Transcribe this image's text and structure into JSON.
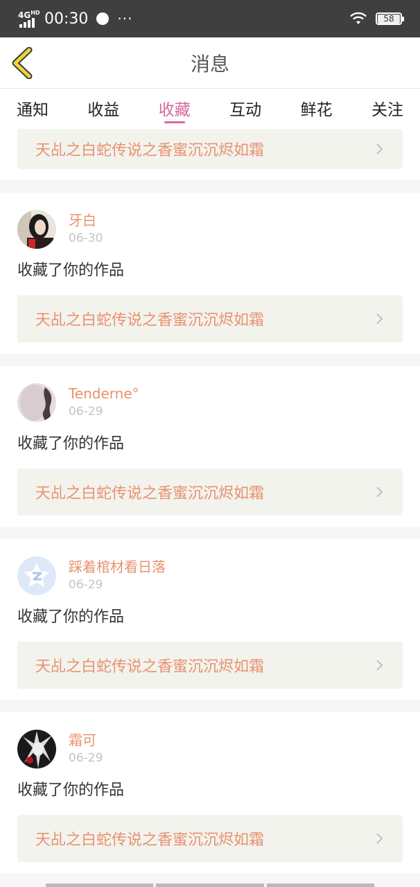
{
  "status_bar": {
    "network": "4G",
    "network_sup": "HD",
    "time": "00:30",
    "more": "···",
    "battery": "58"
  },
  "header": {
    "title": "消息"
  },
  "tabs": [
    {
      "label": "通知"
    },
    {
      "label": "收益"
    },
    {
      "label": "收藏",
      "active": true
    },
    {
      "label": "互动"
    },
    {
      "label": "鲜花"
    },
    {
      "label": "关注"
    }
  ],
  "partial_card": {
    "work_title": "天乩之白蛇传说之香蜜沉沉烬如霜"
  },
  "items": [
    {
      "username": "牙白",
      "date": "06-30",
      "action": "收藏了你的作品",
      "work_title": "天乩之白蛇传说之香蜜沉沉烬如霜",
      "avatar": "avatar-photo-girl"
    },
    {
      "username": "Tenderne°",
      "date": "06-29",
      "action": "收藏了你的作品",
      "work_title": "天乩之白蛇传说之香蜜沉沉烬如霜",
      "avatar": "avatar-photo-braid"
    },
    {
      "username": "踩着棺材看日落",
      "date": "06-29",
      "action": "收藏了你的作品",
      "work_title": "天乩之白蛇传说之香蜜沉沉烬如霜",
      "avatar": "default-avatar-icon"
    },
    {
      "username": "霜可",
      "date": "06-29",
      "action": "收藏了你的作品",
      "work_title": "天乩之白蛇传说之香蜜沉沉烬如霜",
      "avatar": "avatar-photo-anime"
    }
  ],
  "colors": {
    "accent": "#d46a9a",
    "link": "#e8926e",
    "back": "#e9d63a"
  }
}
